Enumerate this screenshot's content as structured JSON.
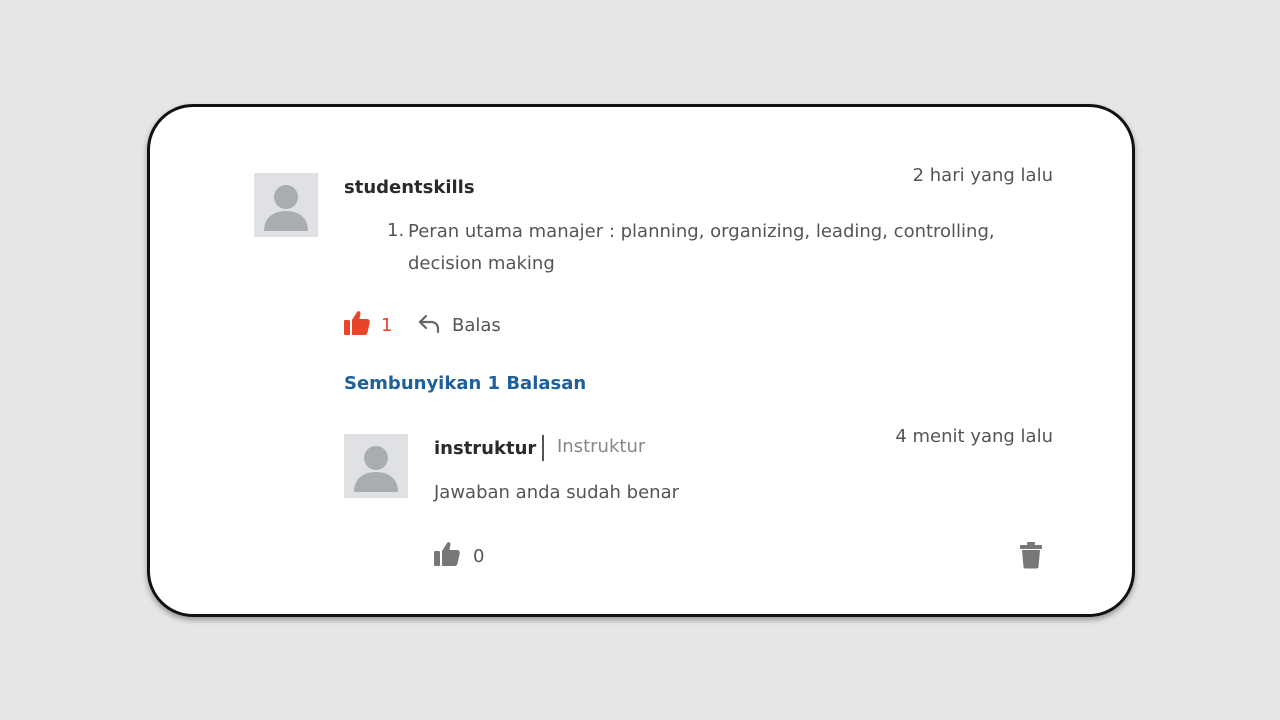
{
  "colors": {
    "accent_like": "#e8442a",
    "link": "#1f5f9a",
    "icon_gray": "#777777"
  },
  "comment": {
    "username": "studentskills",
    "timestamp": "2 hari yang lalu",
    "list_number": "1.",
    "text": "Peran utama manajer : planning, organizing, leading, controlling, decision making",
    "like_icon": "thumbs-up-icon",
    "like_count": "1",
    "reply_icon": "reply-arrow-icon",
    "reply_label": "Balas"
  },
  "replies_toggle": {
    "label": "Sembunyikan 1 Balasan"
  },
  "reply": {
    "username": "instruktur",
    "role": "Instruktur",
    "timestamp": "4 menit yang lalu",
    "text": "Jawaban anda sudah benar",
    "like_icon": "thumbs-up-icon",
    "like_count": "0",
    "delete_icon": "trash-icon"
  }
}
